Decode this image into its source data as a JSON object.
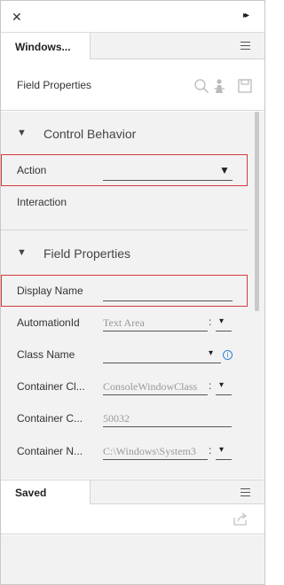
{
  "window": {
    "close_glyph": "✕",
    "expand_glyph": "▸▸"
  },
  "top_tab": {
    "label": "Windows..."
  },
  "subheader": {
    "title": "Field Properties"
  },
  "control_behavior": {
    "label": "Control Behavior",
    "rows": {
      "action": "Action",
      "interaction": "Interaction"
    }
  },
  "field_properties": {
    "label": "Field Properties",
    "rows": {
      "display_name": {
        "label": "Display Name",
        "value": ""
      },
      "automation_id": {
        "label": "AutomationId",
        "value": "Text Area"
      },
      "class_name": {
        "label": "Class Name",
        "value": ""
      },
      "container_class": {
        "label": "Container Cl...",
        "value": "ConsoleWindowClass"
      },
      "container_c": {
        "label": "Container C...",
        "value": "50032"
      },
      "container_name": {
        "label": "Container N...",
        "value": "C:\\Windows\\System3"
      }
    }
  },
  "saved_tab": {
    "label": "Saved"
  },
  "icons": {
    "search": "search-icon",
    "user": "person-icon",
    "save": "save-icon",
    "share": "export-icon",
    "menu": "menu-icon",
    "info": "info-icon"
  },
  "colors": {
    "highlight": "#d53a3a",
    "info": "#2d7fd3"
  }
}
